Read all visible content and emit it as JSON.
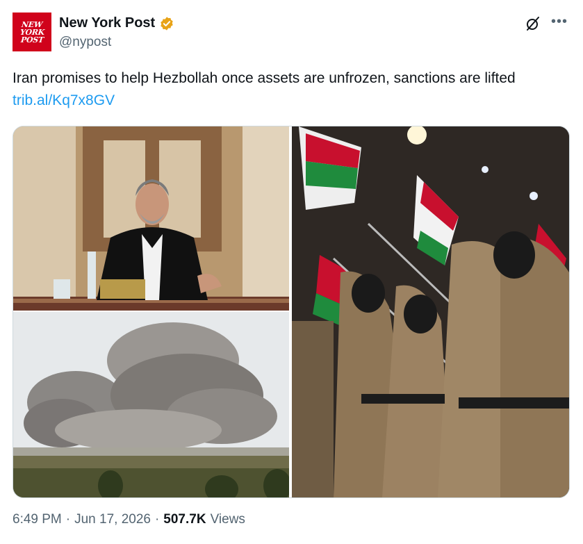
{
  "account": {
    "logo_lines": [
      "NEW",
      "YORK",
      "POST"
    ],
    "name": "New York Post",
    "handle": "@nypost",
    "verified_color": "#e8a317"
  },
  "tweet": {
    "text": "Iran promises to help Hezbollah once assets are unfrozen, sanctions are lifted ",
    "link": "trib.al/Kq7x8GV"
  },
  "icons": {
    "grok": "grok-icon",
    "more": "more-icon",
    "verified": "verified-badge-icon"
  },
  "media": [
    {
      "name": "meeting-photo"
    },
    {
      "name": "smoke-photo"
    },
    {
      "name": "parade-photo"
    }
  ],
  "footer": {
    "time": "6:49 PM",
    "separator": "·",
    "date": "Jun 17, 2026",
    "views_count": "507.7K",
    "views_label": "Views"
  },
  "colors": {
    "link": "#1d9bf0",
    "brand_red": "#d0021b",
    "muted": "#536471"
  }
}
